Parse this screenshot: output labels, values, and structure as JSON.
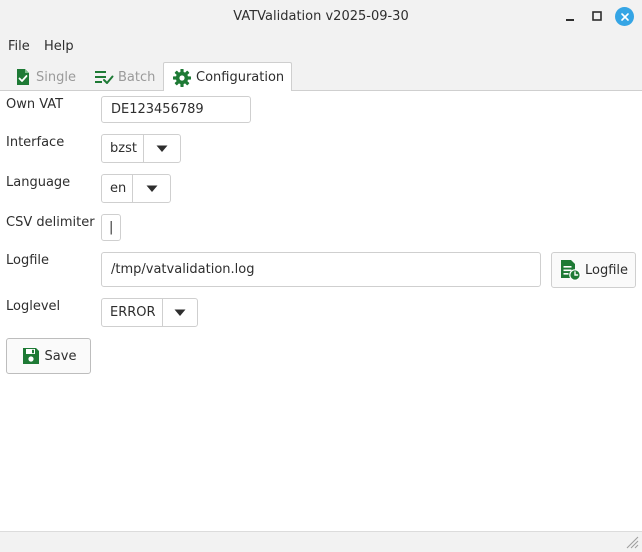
{
  "window": {
    "title": "VATValidation v2025-09-30",
    "close_color": "#35a5e5"
  },
  "menu": {
    "file": "File",
    "help": "Help"
  },
  "tabs": [
    {
      "label": "Single",
      "icon": "document-check-icon",
      "active": false
    },
    {
      "label": "Batch",
      "icon": "list-check-icon",
      "active": false
    },
    {
      "label": "Configuration",
      "icon": "gear-icon",
      "active": true
    }
  ],
  "config": {
    "own_vat": {
      "label": "Own VAT",
      "value": "DE123456789"
    },
    "interface": {
      "label": "Interface",
      "value": "bzst"
    },
    "language": {
      "label": "Language",
      "value": "en"
    },
    "csv_delimiter": {
      "label": "CSV delimiter",
      "value": "|"
    },
    "logfile": {
      "label": "Logfile",
      "value": "/tmp/vatvalidation.log",
      "button": "Logfile"
    },
    "loglevel": {
      "label": "Loglevel",
      "value": "ERROR"
    },
    "save_label": "Save"
  },
  "colors": {
    "icon_green": "#1e7a35",
    "accent_blue": "#35a5e5"
  }
}
